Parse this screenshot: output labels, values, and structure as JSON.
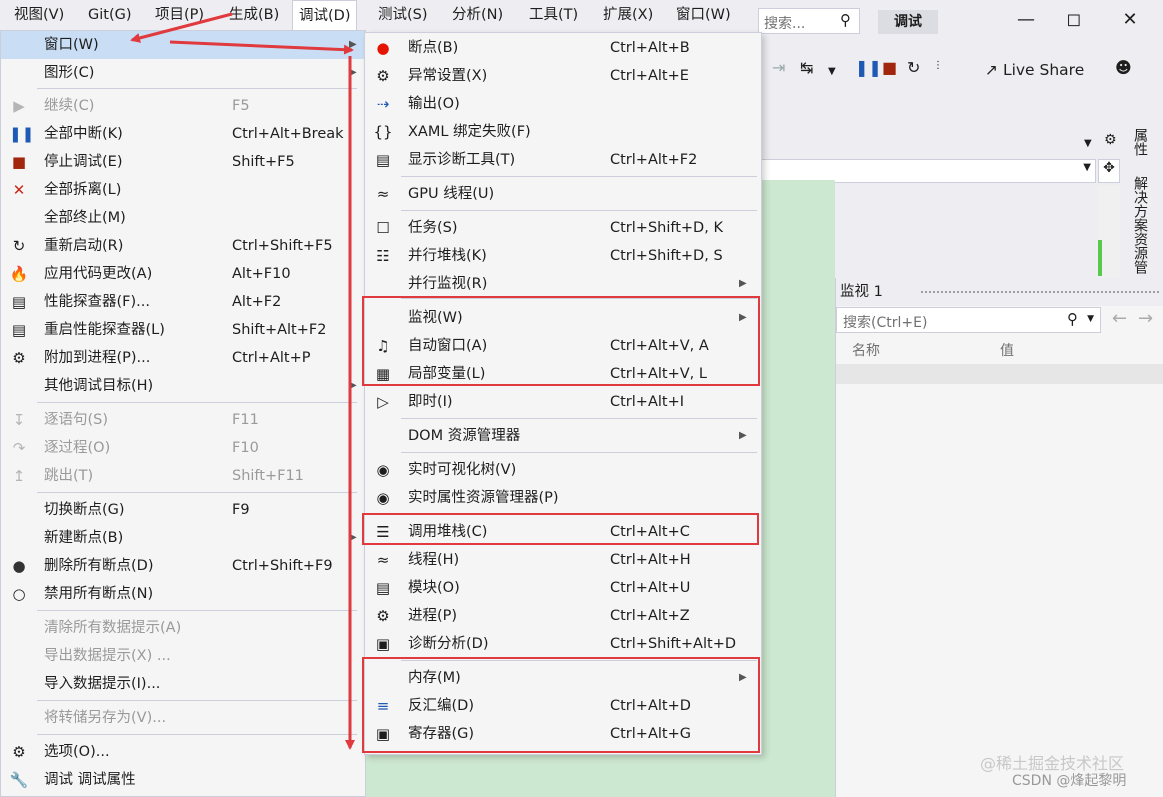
{
  "menubar": {
    "items": [
      "视图(V)",
      "Git(G)",
      "项目(P)",
      "生成(B)",
      "调试(D)",
      "测试(S)",
      "分析(N)",
      "工具(T)",
      "扩展(X)",
      "窗口(W)"
    ],
    "search_placeholder": "搜索...",
    "mode_badge": "调试"
  },
  "toolbar": {
    "live_share": "Live Share"
  },
  "side_tabs": [
    "属性",
    "解决方案资源管"
  ],
  "watch": {
    "title": "监视 1",
    "search_placeholder": "搜索(Ctrl+E)",
    "col_name": "名称",
    "col_value": "值"
  },
  "debug_menu": [
    {
      "label": "窗口(W)",
      "shortcut": "",
      "icon": "",
      "enabled": true,
      "submenu": true
    },
    {
      "label": "图形(C)",
      "shortcut": "",
      "icon": "",
      "enabled": true,
      "submenu": true
    },
    {
      "label": "继续(C)",
      "shortcut": "F5",
      "icon": "play-icon",
      "enabled": false
    },
    {
      "label": "全部中断(K)",
      "shortcut": "Ctrl+Alt+Break",
      "icon": "pause-icon",
      "enabled": true
    },
    {
      "label": "停止调试(E)",
      "shortcut": "Shift+F5",
      "icon": "stop-icon",
      "enabled": true
    },
    {
      "label": "全部拆离(L)",
      "shortcut": "",
      "icon": "detach-icon",
      "enabled": true
    },
    {
      "label": "全部终止(M)",
      "shortcut": "",
      "icon": "",
      "enabled": true
    },
    {
      "label": "重新启动(R)",
      "shortcut": "Ctrl+Shift+F5",
      "icon": "restart-icon",
      "enabled": true
    },
    {
      "label": "应用代码更改(A)",
      "shortcut": "Alt+F10",
      "icon": "hot-reload-icon",
      "enabled": true
    },
    {
      "label": "性能探查器(F)...",
      "shortcut": "Alt+F2",
      "icon": "profiler-icon",
      "enabled": true
    },
    {
      "label": "重启性能探查器(L)",
      "shortcut": "Shift+Alt+F2",
      "icon": "profiler-restart-icon",
      "enabled": true
    },
    {
      "label": "附加到进程(P)...",
      "shortcut": "Ctrl+Alt+P",
      "icon": "attach-icon",
      "enabled": true
    },
    {
      "label": "其他调试目标(H)",
      "shortcut": "",
      "icon": "",
      "enabled": true,
      "submenu": true
    },
    {
      "label": "逐语句(S)",
      "shortcut": "F11",
      "icon": "step-into-icon",
      "enabled": false
    },
    {
      "label": "逐过程(O)",
      "shortcut": "F10",
      "icon": "step-over-icon",
      "enabled": false
    },
    {
      "label": "跳出(T)",
      "shortcut": "Shift+F11",
      "icon": "step-out-icon",
      "enabled": false
    },
    {
      "label": "切换断点(G)",
      "shortcut": "F9",
      "icon": "",
      "enabled": true
    },
    {
      "label": "新建断点(B)",
      "shortcut": "",
      "icon": "",
      "enabled": true,
      "submenu": true
    },
    {
      "label": "删除所有断点(D)",
      "shortcut": "Ctrl+Shift+F9",
      "icon": "delete-breakpoints-icon",
      "enabled": true
    },
    {
      "label": "禁用所有断点(N)",
      "shortcut": "",
      "icon": "disable-breakpoints-icon",
      "enabled": true
    },
    {
      "label": "清除所有数据提示(A)",
      "shortcut": "",
      "icon": "",
      "enabled": false
    },
    {
      "label": "导出数据提示(X) ...",
      "shortcut": "",
      "icon": "",
      "enabled": false
    },
    {
      "label": "导入数据提示(I)...",
      "shortcut": "",
      "icon": "",
      "enabled": true
    },
    {
      "label": "将转储另存为(V)...",
      "shortcut": "",
      "icon": "",
      "enabled": false
    },
    {
      "label": "选项(O)...",
      "shortcut": "",
      "icon": "gear-icon",
      "enabled": true
    },
    {
      "label": "调试 调试属性",
      "shortcut": "",
      "icon": "wrench-icon",
      "enabled": true
    }
  ],
  "window_submenu": [
    {
      "label": "断点(B)",
      "shortcut": "Ctrl+Alt+B",
      "icon": "breakpoint-icon"
    },
    {
      "label": "异常设置(X)",
      "shortcut": "Ctrl+Alt+E",
      "icon": "exception-icon"
    },
    {
      "label": "输出(O)",
      "shortcut": "",
      "icon": "output-icon"
    },
    {
      "label": "XAML 绑定失败(F)",
      "shortcut": "",
      "icon": "xaml-icon"
    },
    {
      "label": "显示诊断工具(T)",
      "shortcut": "Ctrl+Alt+F2",
      "icon": "diagnostics-icon"
    },
    {
      "label": "GPU 线程(U)",
      "shortcut": "",
      "icon": "gpu-threads-icon"
    },
    {
      "label": "任务(S)",
      "shortcut": "Ctrl+Shift+D, K",
      "icon": "tasks-icon"
    },
    {
      "label": "并行堆栈(K)",
      "shortcut": "Ctrl+Shift+D, S",
      "icon": "parallel-stacks-icon"
    },
    {
      "label": "并行监视(R)",
      "shortcut": "",
      "icon": "",
      "submenu": true
    },
    {
      "label": "监视(W)",
      "shortcut": "",
      "icon": "",
      "submenu": true
    },
    {
      "label": "自动窗口(A)",
      "shortcut": "Ctrl+Alt+V, A",
      "icon": "autos-icon"
    },
    {
      "label": "局部变量(L)",
      "shortcut": "Ctrl+Alt+V, L",
      "icon": "locals-icon"
    },
    {
      "label": "即时(I)",
      "shortcut": "Ctrl+Alt+I",
      "icon": "immediate-icon"
    },
    {
      "label": "DOM 资源管理器",
      "shortcut": "",
      "icon": "",
      "submenu": true
    },
    {
      "label": "实时可视化树(V)",
      "shortcut": "",
      "icon": "camera-icon"
    },
    {
      "label": "实时属性资源管理器(P)",
      "shortcut": "",
      "icon": "camera-icon"
    },
    {
      "label": "调用堆栈(C)",
      "shortcut": "Ctrl+Alt+C",
      "icon": "call-stack-icon"
    },
    {
      "label": "线程(H)",
      "shortcut": "Ctrl+Alt+H",
      "icon": "threads-icon"
    },
    {
      "label": "模块(O)",
      "shortcut": "Ctrl+Alt+U",
      "icon": "modules-icon"
    },
    {
      "label": "进程(P)",
      "shortcut": "Ctrl+Alt+Z",
      "icon": "processes-icon"
    },
    {
      "label": "诊断分析(D)",
      "shortcut": "Ctrl+Shift+Alt+D",
      "icon": "diagnostic-analysis-icon"
    },
    {
      "label": "内存(M)",
      "shortcut": "",
      "icon": "",
      "submenu": true
    },
    {
      "label": "反汇编(D)",
      "shortcut": "Ctrl+Alt+D",
      "icon": "disassembly-icon"
    },
    {
      "label": "寄存器(G)",
      "shortcut": "Ctrl+Alt+G",
      "icon": "registers-icon"
    }
  ],
  "watermark": "@稀土掘金技术社区",
  "watermark2": "CSDN @烽起黎明",
  "colors": {
    "highlight_box": "#e0393e",
    "arrow": "#e0393e",
    "editor_bg": "#cde8d0"
  }
}
